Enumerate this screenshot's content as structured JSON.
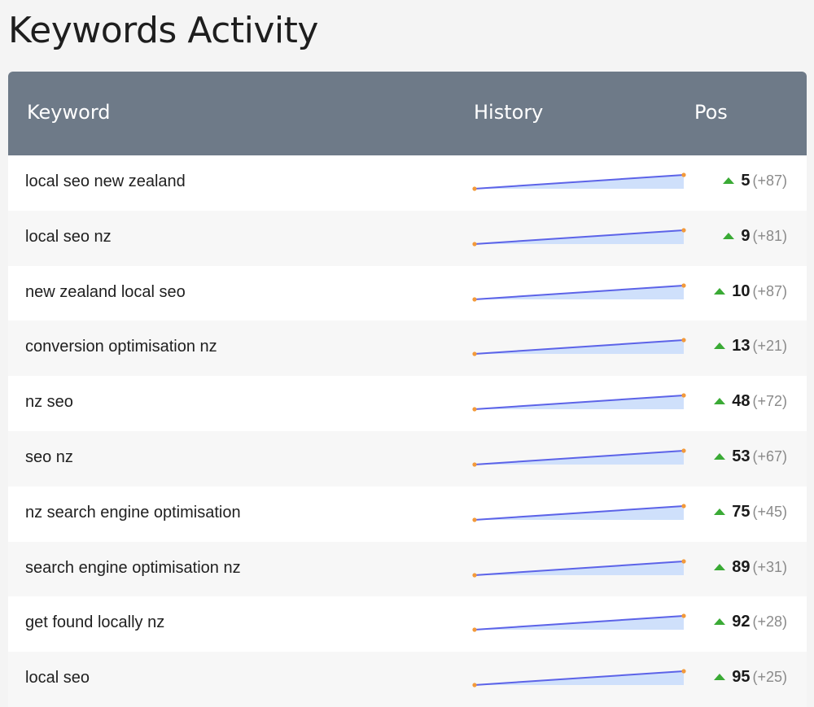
{
  "page": {
    "title": "Keywords Activity"
  },
  "table": {
    "headers": {
      "keyword": "Keyword",
      "history": "History",
      "pos": "Pos"
    },
    "rows": [
      {
        "keyword": "local seo new zealand",
        "pos": "5",
        "change": "(+87)"
      },
      {
        "keyword": "local seo nz",
        "pos": "9",
        "change": "(+81)"
      },
      {
        "keyword": "new zealand local seo",
        "pos": "10",
        "change": "(+87)"
      },
      {
        "keyword": "conversion optimisation nz",
        "pos": "13",
        "change": "(+21)"
      },
      {
        "keyword": "nz seo",
        "pos": "48",
        "change": "(+72)"
      },
      {
        "keyword": "seo nz",
        "pos": "53",
        "change": "(+67)"
      },
      {
        "keyword": "nz search engine optimisation",
        "pos": "75",
        "change": "(+45)"
      },
      {
        "keyword": "search engine optimisation nz",
        "pos": "89",
        "change": "(+31)"
      },
      {
        "keyword": "get found locally nz",
        "pos": "92",
        "change": "(+28)"
      },
      {
        "keyword": "local seo",
        "pos": "95",
        "change": "(+25)"
      }
    ]
  },
  "colors": {
    "header_bg": "#6e7a88",
    "spark_line": "#5c63e8",
    "spark_fill": "#cfe0fb",
    "spark_dot": "#f39a3a",
    "up_arrow": "#3aaa35"
  },
  "icons": {
    "trend_up": "triangle-up-icon"
  }
}
